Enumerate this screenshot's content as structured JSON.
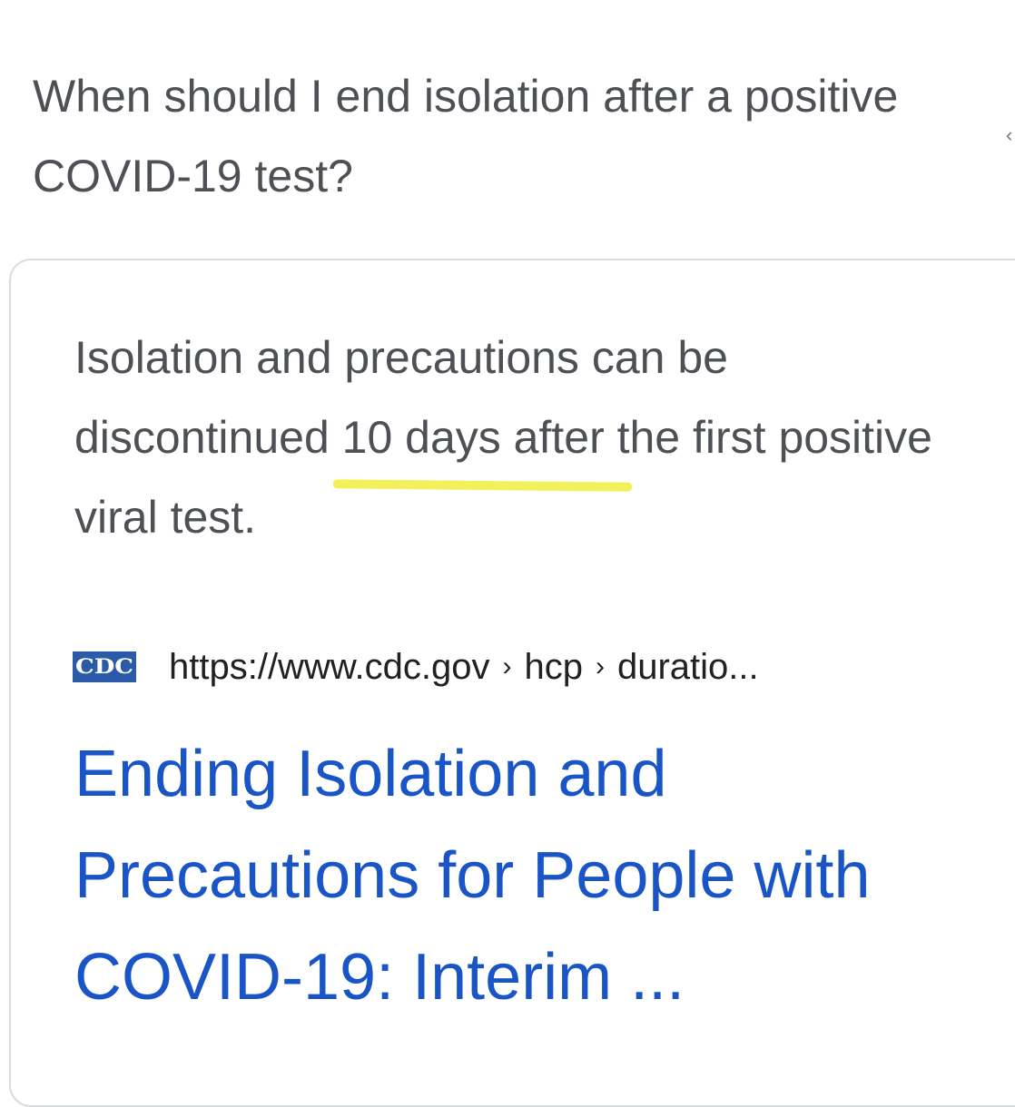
{
  "question": "When should I end isolation after a positive COVID-19 test?",
  "snippet": {
    "before": "Isolation and precautions can be discontinued ",
    "highlight": "10 days after",
    "after": " the first positive viral test.",
    "highlight_color": "#f3f05a"
  },
  "source": {
    "favicon_text": "CDC",
    "url": "https://www.cdc.gov",
    "crumbs": [
      "hcp",
      "duratio..."
    ],
    "separator": "›"
  },
  "result": {
    "title": "Ending Isolation and Precautions for People with COVID-19: Interim ...",
    "color": "#1a55c7"
  },
  "icons": {
    "edge": "expand-chevron-icon"
  }
}
